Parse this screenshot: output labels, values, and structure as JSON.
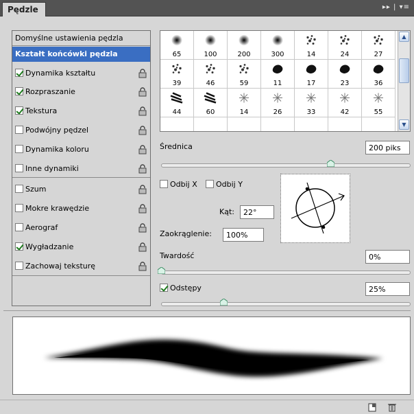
{
  "panel": {
    "title": "Pędzle",
    "menu_glyphs": "▸▸ | ▾≡"
  },
  "presets_button": "Domyślne ustawienia pędzla",
  "sections": [
    {
      "label": "Kształt końcówki pędzla",
      "checked": null,
      "locked": false,
      "selected": true
    },
    {
      "label": "Dynamika kształtu",
      "checked": true,
      "locked": true
    },
    {
      "label": "Rozpraszanie",
      "checked": true,
      "locked": true
    },
    {
      "label": "Tekstura",
      "checked": true,
      "locked": true
    },
    {
      "label": "Podwójny pędzel",
      "checked": false,
      "locked": true
    },
    {
      "label": "Dynamika koloru",
      "checked": false,
      "locked": true
    },
    {
      "label": "Inne dynamiki",
      "checked": false,
      "locked": true
    },
    {
      "label": "Szum",
      "checked": false,
      "locked": true
    },
    {
      "label": "Mokre krawędzie",
      "checked": false,
      "locked": true
    },
    {
      "label": "Aerograf",
      "checked": false,
      "locked": true
    },
    {
      "label": "Wygładzanie",
      "checked": true,
      "locked": true
    },
    {
      "label": "Zachowaj teksturę",
      "checked": false,
      "locked": true
    }
  ],
  "brush_tips": {
    "row1": [
      "65",
      "100",
      "200",
      "300",
      "14",
      "24",
      "27"
    ],
    "row2": [
      "39",
      "46",
      "59",
      "11",
      "17",
      "23",
      "36"
    ],
    "row3": [
      "44",
      "60",
      "14",
      "26",
      "33",
      "42",
      "55"
    ]
  },
  "diameter": {
    "label": "Średnica",
    "value": "200 piks",
    "slider_fraction": 0.68
  },
  "flip_x": {
    "label": "Odbij X",
    "checked": false
  },
  "flip_y": {
    "label": "Odbij Y",
    "checked": false
  },
  "angle": {
    "label": "Kąt:",
    "value": "22°"
  },
  "roundness": {
    "label": "Zaokrąglenie:",
    "value": "100%"
  },
  "hardness": {
    "label": "Twardość",
    "value": "0%",
    "slider_fraction": 0.0
  },
  "spacing": {
    "label": "Odstępy",
    "value": "25%",
    "checked": true,
    "slider_fraction": 0.25
  },
  "icons": {
    "lock": "lock-icon",
    "new_preset": "new-brush-icon",
    "trash": "trash-icon"
  },
  "colors": {
    "selection": "#3a6ec2",
    "titlebar": "#535353",
    "check": "#1e7b1e"
  }
}
